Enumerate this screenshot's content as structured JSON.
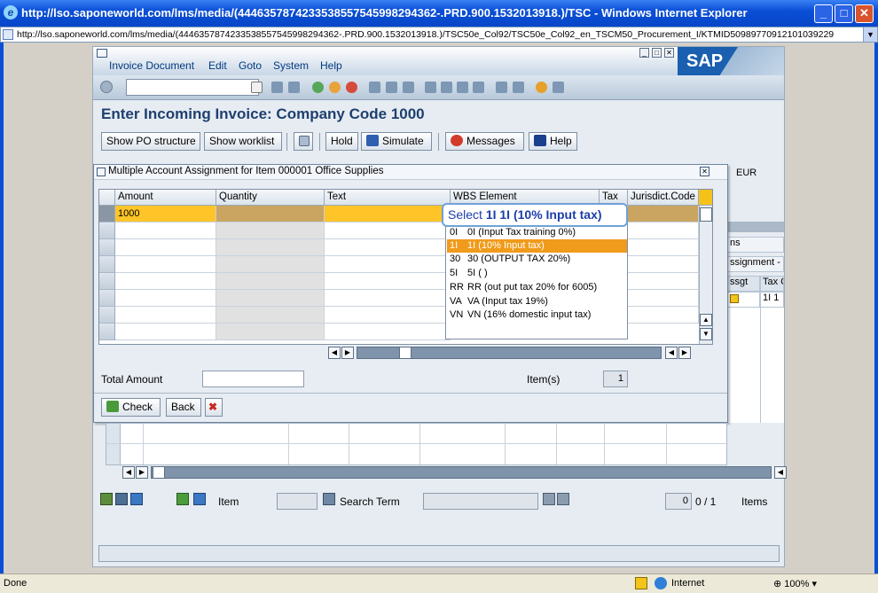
{
  "window": {
    "title": "http://lso.saponeworld.com/lms/media/(4446357874233538557545998294362-.PRD.900.1532013918.)/TSC - Windows Internet Explorer"
  },
  "address": {
    "url": "http://lso.saponeworld.com/lms/media/(4446357874233538557545998294362-.PRD.900.1532013918.)/TSC50e_Col92/TSC50e_Col92_en_TSCM50_Procurement_I/KTMID50989770912101039229"
  },
  "menu": {
    "items": [
      "Invoice Document",
      "Edit",
      "Goto",
      "System",
      "Help"
    ]
  },
  "sap_logo": "SAP",
  "page_title": "Enter Incoming Invoice: Company Code 1000",
  "appbar": {
    "show_po": "Show PO structure",
    "show_worklist": "Show worklist",
    "hold": "Hold",
    "simulate": "Simulate",
    "messages": "Messages",
    "help": "Help"
  },
  "background": {
    "currency": "EUR",
    "ns": "ns",
    "assignment": "ssignment -",
    "assgt": "ssgt",
    "taxc": "Tax C",
    "taxval": "1I  1"
  },
  "dialog": {
    "title": "Multiple Account Assignment for Item 000001 Office Supplies",
    "columns": {
      "amount": "Amount",
      "quantity": "Quantity",
      "text": "Text",
      "wbs": "WBS Element",
      "tax": "Tax",
      "jurisdict": "Jurisdict.Code"
    },
    "row1_amount": "1000",
    "total_label": "Total Amount",
    "items_label": "Item(s)",
    "items_value": "1",
    "check": "Check",
    "back": "Back"
  },
  "tooltip": {
    "prefix": "Select",
    "bold": "1I",
    "rest": "1I (10% Input tax)"
  },
  "dropdown": [
    {
      "key": "0I",
      "text": "0I (Input Tax training 0%)"
    },
    {
      "key": "1I",
      "text": "1I (10% Input tax)"
    },
    {
      "key": "30",
      "text": "30 (OUTPUT TAX 20%)"
    },
    {
      "key": "5I",
      "text": "5I ( )"
    },
    {
      "key": "RR",
      "text": "RR (out put tax 20% for 6005)"
    },
    {
      "key": "VA",
      "text": "VA (Input tax 19%)"
    },
    {
      "key": "VN",
      "text": "VN (16% domestic input tax)"
    }
  ],
  "footer": {
    "item": "Item",
    "search_term": "Search Term",
    "page": "0 / 1",
    "items": "Items"
  },
  "statusbar": {
    "left": "Done",
    "zone": "Internet",
    "zoom": "100%"
  }
}
